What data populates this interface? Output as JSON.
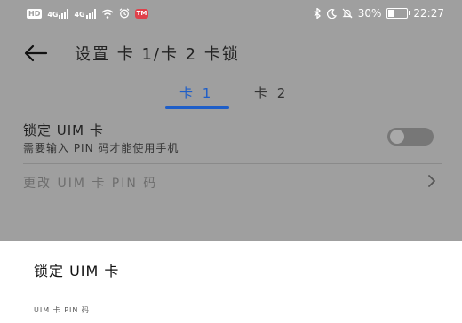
{
  "status_bar": {
    "hd": "HD",
    "sim1_signal": "4G",
    "sim2_signal": "4G",
    "app_badge": "TM",
    "battery_percent": "30%",
    "battery_level": 0.3,
    "time": "22:27"
  },
  "header": {
    "title": "设置 卡 1/卡 2 卡锁"
  },
  "tabs": [
    {
      "label": "卡 1",
      "active": true
    },
    {
      "label": "卡 2",
      "active": false
    }
  ],
  "lock_setting": {
    "title": "锁定 UIM 卡",
    "subtitle": "需要输入 PIN 码才能使用手机",
    "enabled": false
  },
  "change_pin": {
    "label": "更改 UIM 卡 PIN 码"
  },
  "dialog": {
    "title": "锁定 UIM 卡",
    "field_label": "UIM 卡 PIN 码"
  },
  "colors": {
    "accent": "#1e5ec8",
    "scrim": "#9f9f9f"
  }
}
